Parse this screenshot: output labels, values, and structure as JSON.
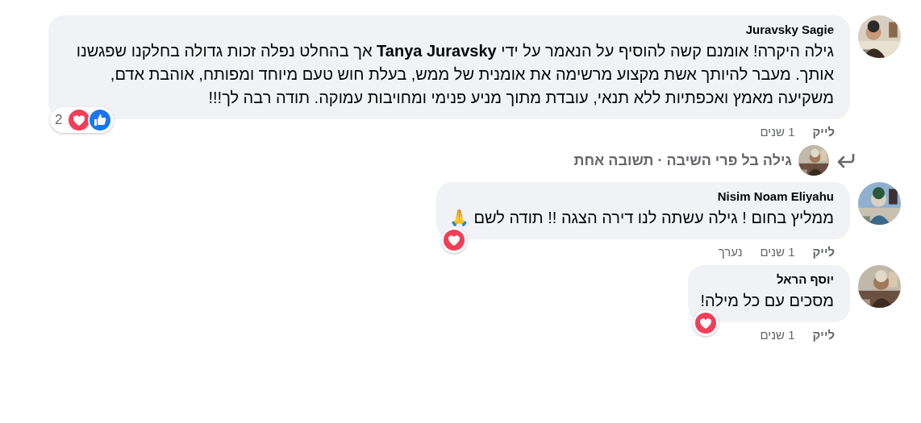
{
  "thread": [
    {
      "kind": "comment",
      "author": "Juravsky Sagie",
      "text": "גילה היקרה! אומנם קשה להוסיף על הנאמר על ידי **Tanya Juravsky** אך בהחלט נפלה זכות גדולה בחלקנו שפגשנו אותך. מעבר להיותך אשת מקצוע מרשימה את אומנית של ממש, בעלת חוש טעם מיוחד ומפותח, אוהבת אדם, משקיעה מאמץ ואכפתיות ללא תנאי, עובדת מתוך מניע פנימי ומחויבות עמוקה. תודה רבה לך!!!",
      "reactions": [
        {
          "kind": "like"
        },
        {
          "kind": "love"
        }
      ],
      "reaction_count": "2",
      "like": "לייק",
      "time": "1 שנים"
    },
    {
      "kind": "replies",
      "author": "גילה בל פרי השיבה",
      "separator": "·",
      "count": "תשובה אחת"
    },
    {
      "kind": "comment",
      "author": "Nisim Noam Eliyahu",
      "text": "ממליץ בחום ! גילה עשתה לנו דירה הצגה !! תודה לשם 🙏",
      "reactions": [
        {
          "kind": "love"
        }
      ],
      "like": "לייק",
      "time": "1 שנים",
      "edited": "נערך"
    },
    {
      "kind": "comment",
      "author": "יוסף הראל",
      "text": "מסכים עם כל מילה!",
      "reactions": [
        {
          "kind": "love"
        }
      ],
      "like": "לייק",
      "time": "1 שנים"
    }
  ]
}
